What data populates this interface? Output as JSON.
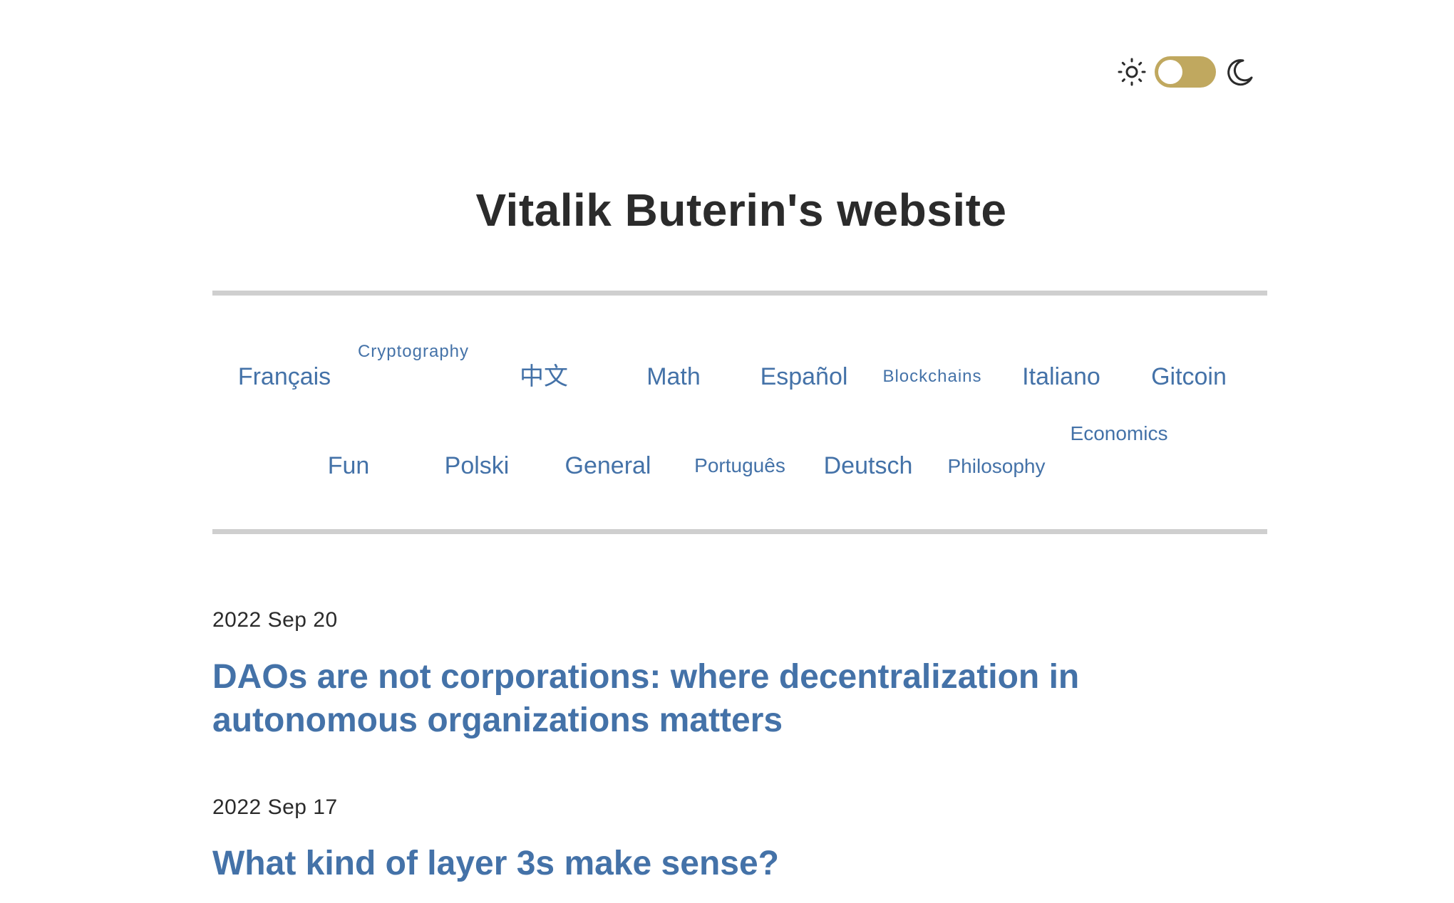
{
  "theme_toggle": {
    "light_icon": "sun-icon",
    "dark_icon": "moon-icon",
    "switch_color": "#c0a85f",
    "state": "light"
  },
  "site": {
    "title": "Vitalik Buterin's website"
  },
  "categories": {
    "row1": [
      "Français",
      "Cryptography",
      "中文",
      "Math",
      "Español",
      "Blockchains",
      "Italiano",
      "Gitcoin"
    ],
    "row2": [
      "Fun",
      "Polski",
      "General",
      "Português",
      "Deutsch",
      "Philosophy",
      "Economics"
    ]
  },
  "posts": [
    {
      "date": "2022 Sep 20",
      "title": "DAOs are not corporations: where decentralization in autonomous organizations matters"
    },
    {
      "date": "2022 Sep 17",
      "title": "What kind of layer 3s make sense?"
    }
  ],
  "colors": {
    "link": "#4472a8",
    "text": "#2b2b2b",
    "rule": "#cfcfcf",
    "accent": "#c0a85f"
  }
}
